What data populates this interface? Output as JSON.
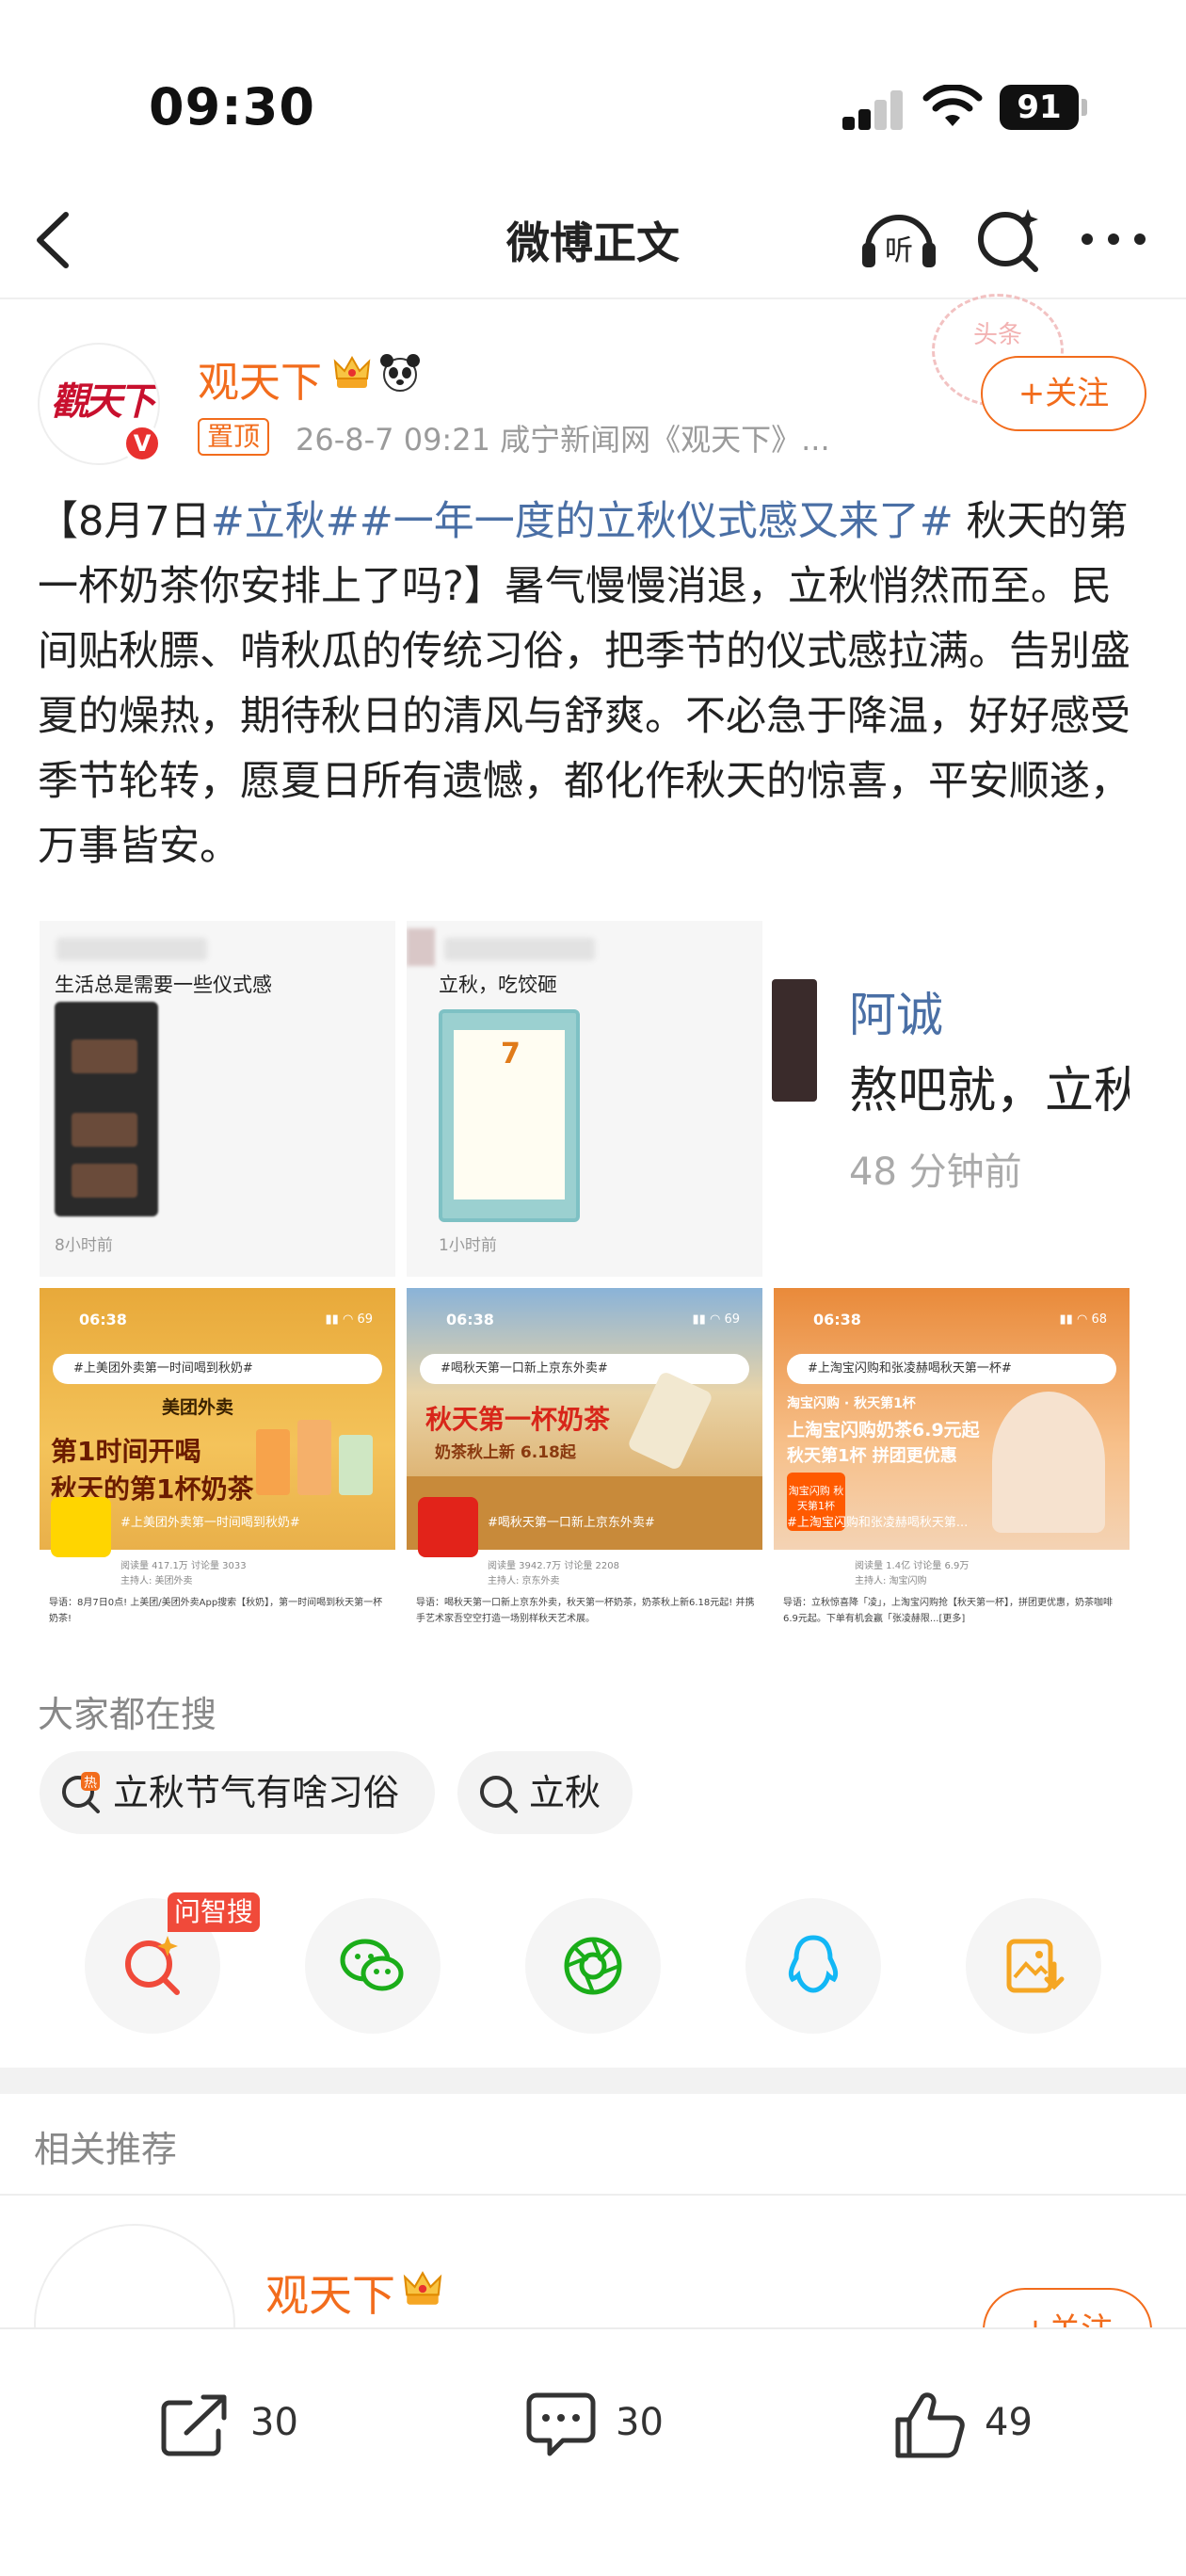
{
  "status": {
    "time": "09:30",
    "battery": "91"
  },
  "nav": {
    "title": "微博正文",
    "listen_label": "听"
  },
  "post": {
    "username": "观天下",
    "pin_label": "置顶",
    "meta": "26-8-7 09:21  咸宁新闻网《观天下》...",
    "stamp_text": "头条",
    "follow_label": "+关注",
    "text_open": "【8月7日",
    "tag1": "#立秋#",
    "tag2": "#一年一度的立秋仪式感又来了#",
    "text_rest": " 秋天的第一杯奶茶你安排上了吗?】暑气慢慢消退，立秋悄然而至。民间贴秋膘、啃秋瓜的传统习俗，把季节的仪式感拉满。告别盛夏的燥热，期待秋日的清风与舒爽。不必急于降温，好好感受季节轮转，愿夏日所有遗憾，都化作秋天的惊喜，平安顺遂，万事皆安。"
  },
  "images": {
    "tile1": {
      "caption": "生活总是需要一些仪式感",
      "time": "8小时前"
    },
    "tile2": {
      "caption": "立秋，吃饺砸",
      "time": "1小时前",
      "poster_day": "7"
    },
    "tile3": {
      "name": "阿诚",
      "text": "熬吧就，立秋",
      "time": "48 分钟前"
    },
    "ads": [
      {
        "status_time": "06:38",
        "search": "#上美团外卖第一时间喝到秋奶#",
        "brand": "美团外卖",
        "headline1": "第1时间开喝",
        "headline2": "秋天的第1杯奶茶",
        "bar": "#上美团外卖第一时间喝到秋奶#",
        "stats": "阅读量 417.1万  讨论量 3033",
        "host": "主持人: 美团外卖",
        "desc": "导语：8月7日0点! 上美团/美团外卖App搜索【秋奶】，第一时间喝到秋天第一杯奶茶!"
      },
      {
        "status_time": "06:38",
        "search": "#喝秋天第一口新上京东外卖#",
        "headline1": "秋天第一杯奶茶",
        "headline2": "奶茶秋上新 6.18起",
        "bar": "#喝秋天第一口新上京东外卖#",
        "stats": "阅读量 3942.7万  讨论量 2208",
        "host": "主持人: 京东外卖",
        "desc": "导语：喝秋天第一口新上京东外卖，秋天第一杯奶茶，奶茶秋上新6.18元起! 并携手艺术家吾空空打造一场别样秋天艺术展。"
      },
      {
        "status_time": "06:38",
        "search": "#上淘宝闪购和张凌赫喝秋天第一杯#",
        "brand": "淘宝闪购 · 秋天第1杯",
        "headline1": "上淘宝闪购奶茶6.9元起",
        "headline2": "秋天第1杯 拼团更优惠",
        "badge": "淘宝闪购 秋天第1杯",
        "bar": "#上淘宝闪购和张凌赫喝秋天第...",
        "stats": "阅读量 1.4亿  讨论量 6.9万",
        "host": "主持人: 淘宝闪购",
        "desc": "导语：立秋惊喜降「凌」，上淘宝闪购抢【秋天第一杯】，拼团更优惠，奶茶咖啡6.9元起。下单有机会赢「张凌赫限...[更多]"
      }
    ]
  },
  "search_section": {
    "title": "大家都在搜",
    "chips": [
      "立秋节气有啥习俗",
      "立秋"
    ]
  },
  "share": {
    "ai_badge": "问智搜"
  },
  "related": {
    "title": "相关推荐",
    "username": "观天下",
    "follow_label": "+关注"
  },
  "bottom": {
    "repost": "30",
    "comment": "30",
    "like": "49"
  },
  "colors": {
    "brand_orange": "#f26c1c",
    "tag_blue": "#4a6fa5"
  }
}
